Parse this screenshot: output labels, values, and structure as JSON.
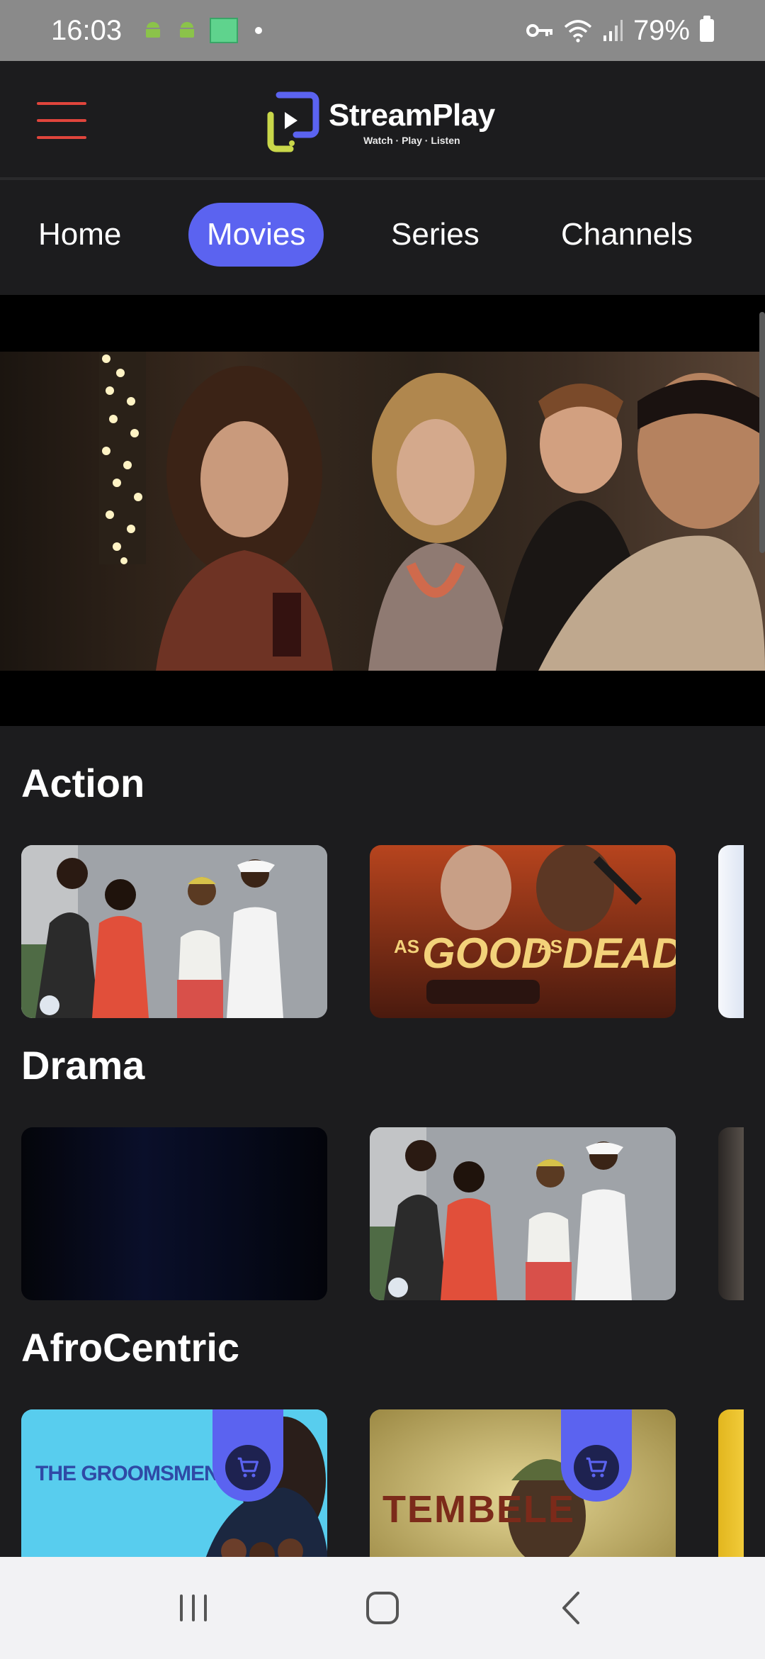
{
  "status_bar": {
    "time": "16:03",
    "battery": "79%",
    "icons": [
      "android-icon",
      "android-icon",
      "notification-square-icon",
      "dot-icon",
      "vpn-key-icon",
      "wifi-icon",
      "signal-icon",
      "battery-icon"
    ]
  },
  "header": {
    "logo_name": "StreamPlay",
    "logo_tagline": "Watch · Play · Listen",
    "menu_icon": "hamburger-icon",
    "accent_color": "#e0453c"
  },
  "tabs": [
    {
      "label": "Home",
      "active": false
    },
    {
      "label": "Movies",
      "active": true
    },
    {
      "label": "Series",
      "active": false
    },
    {
      "label": "Channels",
      "active": false
    }
  ],
  "active_tab_color": "#5b63f0",
  "sections": [
    {
      "title": "Action",
      "cards": [
        {
          "art_text": ""
        },
        {
          "art_text_a": "AS",
          "art_text_b": "GOOD",
          "art_text_c": "AS",
          "art_text_d": "DEAD"
        }
      ]
    },
    {
      "title": "Drama",
      "cards": [
        {
          "art_text": ""
        },
        {
          "art_text": ""
        }
      ]
    },
    {
      "title": "AfroCentric",
      "cards": [
        {
          "art_text": "THE GROOMSMEN",
          "purchase_icon": "cart-icon"
        },
        {
          "art_text": "TEMBELE",
          "purchase_icon": "cart-icon"
        }
      ]
    }
  ],
  "nav_bar": {
    "icons": [
      "recent-apps-icon",
      "home-icon",
      "back-icon"
    ]
  }
}
